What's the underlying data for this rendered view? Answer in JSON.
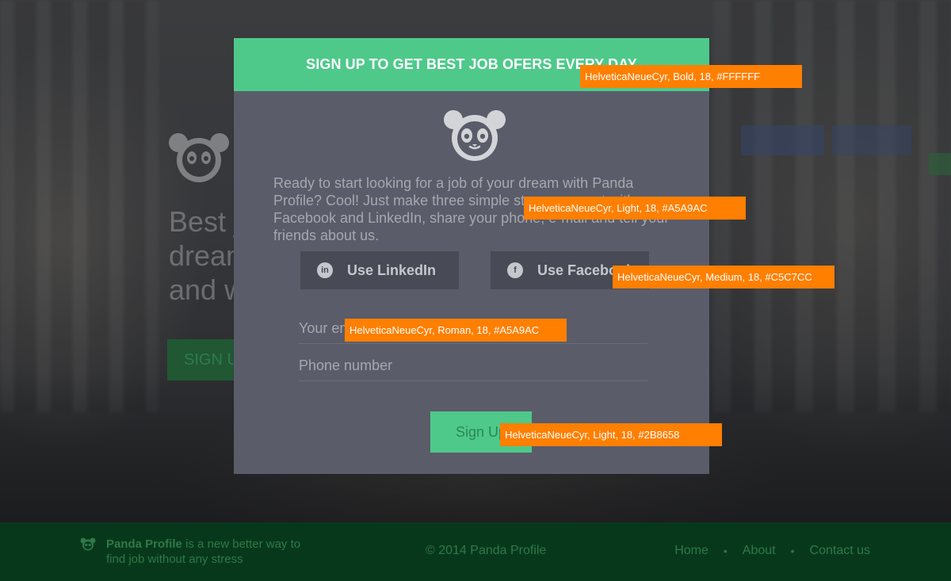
{
  "hero": {
    "headline": "Best j\ndream\nand w",
    "cta_label": "SIGN U"
  },
  "modal": {
    "title": "SIGN UP TO GET BEST JOB OFERS EVERY DAY",
    "intro_text": "Ready to start looking for a job of your dream with Panda Profile? Cool! Just make three simple steps: connect with Facebook and LinkedIn, share your phone, e-mail and tell your friends about us.",
    "linkedin_label": "Use LinkedIn",
    "facebook_label": "Use Facebook",
    "linkedin_icon": "in",
    "facebook_icon": "f",
    "email_placeholder": "Your email",
    "phone_placeholder": "Phone number",
    "signup_label": "Sign Up"
  },
  "annotations": [
    "HelveticaNeueCyr, Bold, 18, #FFFFFF",
    "HelveticaNeueCyr, Light, 18, #A5A9AC",
    "HelveticaNeueCyr, Medium, 18, #C5C7CC",
    "HelveticaNeueCyr, Roman, 18, #A5A9AC",
    "HelveticaNeueCyr, Light, 18, #2B8658"
  ],
  "footer": {
    "brand": "Panda Profile",
    "tagline": " is a new better way to find job without any stress",
    "copyright": "© 2014 Panda Profile",
    "nav": [
      "Home",
      "About",
      "Contact us"
    ],
    "separator": "•"
  },
  "colors": {
    "header_green": "#4ec98a",
    "modal_bg": "#5a5c6a",
    "social_btn_bg": "#484a55",
    "text_muted": "#A5A9AC",
    "text_light": "#C5C7CC",
    "signup_text": "#2B8658",
    "footer_bg": "#08381b",
    "annotation_orange": "#ff7f00"
  },
  "icons": {
    "panda_logo": "panda-logo-icon",
    "linkedin": "linkedin-icon",
    "facebook": "facebook-icon"
  }
}
